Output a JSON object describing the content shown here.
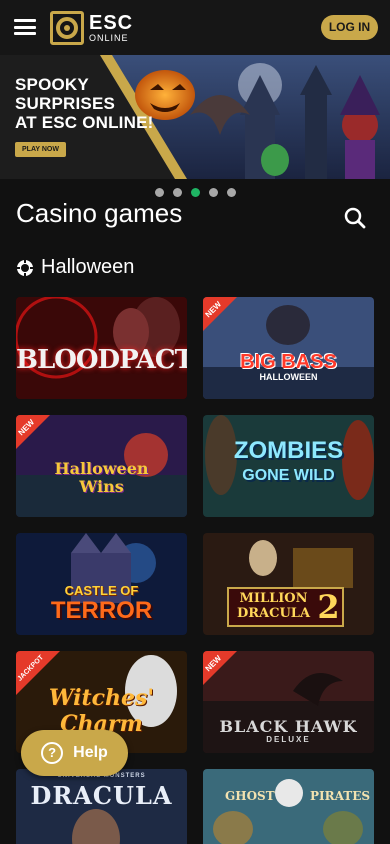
{
  "header": {
    "logo_big": "ESC",
    "logo_small": "ONLINE",
    "login_label": "LOG IN"
  },
  "banner": {
    "title_line1": "SPOOKY",
    "title_line2": "SURPRISES",
    "title_line3": "AT ESC ONLINE!",
    "cta_label": "PLAY NOW",
    "slides": 5,
    "active_slide": 3
  },
  "section": {
    "title": "Casino games",
    "category": "Halloween"
  },
  "games": [
    {
      "title": "BLOODPACT",
      "badge": ""
    },
    {
      "title": "BIG BASS",
      "subtitle": "HALLOWEEN",
      "badge": "NEW"
    },
    {
      "title": "Halloween",
      "subtitle": "Wins",
      "badge": "NEW"
    },
    {
      "title": "ZOMBIES",
      "subtitle": "GONE WILD",
      "badge": ""
    },
    {
      "title": "CASTLE OF",
      "subtitle": "TERROR",
      "badge": ""
    },
    {
      "title": "MILLION",
      "subtitle": "DRACULA",
      "extra": "2",
      "badge": ""
    },
    {
      "title": "Witches'",
      "subtitle": "Charm",
      "badge": "JACKPOT"
    },
    {
      "title": "BLACK HAWK",
      "subtitle": "DELUXE",
      "badge": "NEW"
    },
    {
      "title": "DRACULA",
      "subtitle": "UNIVERSAL MONSTERS",
      "badge": ""
    },
    {
      "title": "GHOST",
      "subtitle": "PIRATES",
      "badge": ""
    }
  ],
  "help": {
    "label": "Help",
    "glyph": "?"
  },
  "colors": {
    "gold": "#c9a84a",
    "active_dot": "#1fb564",
    "background": "#111111"
  }
}
